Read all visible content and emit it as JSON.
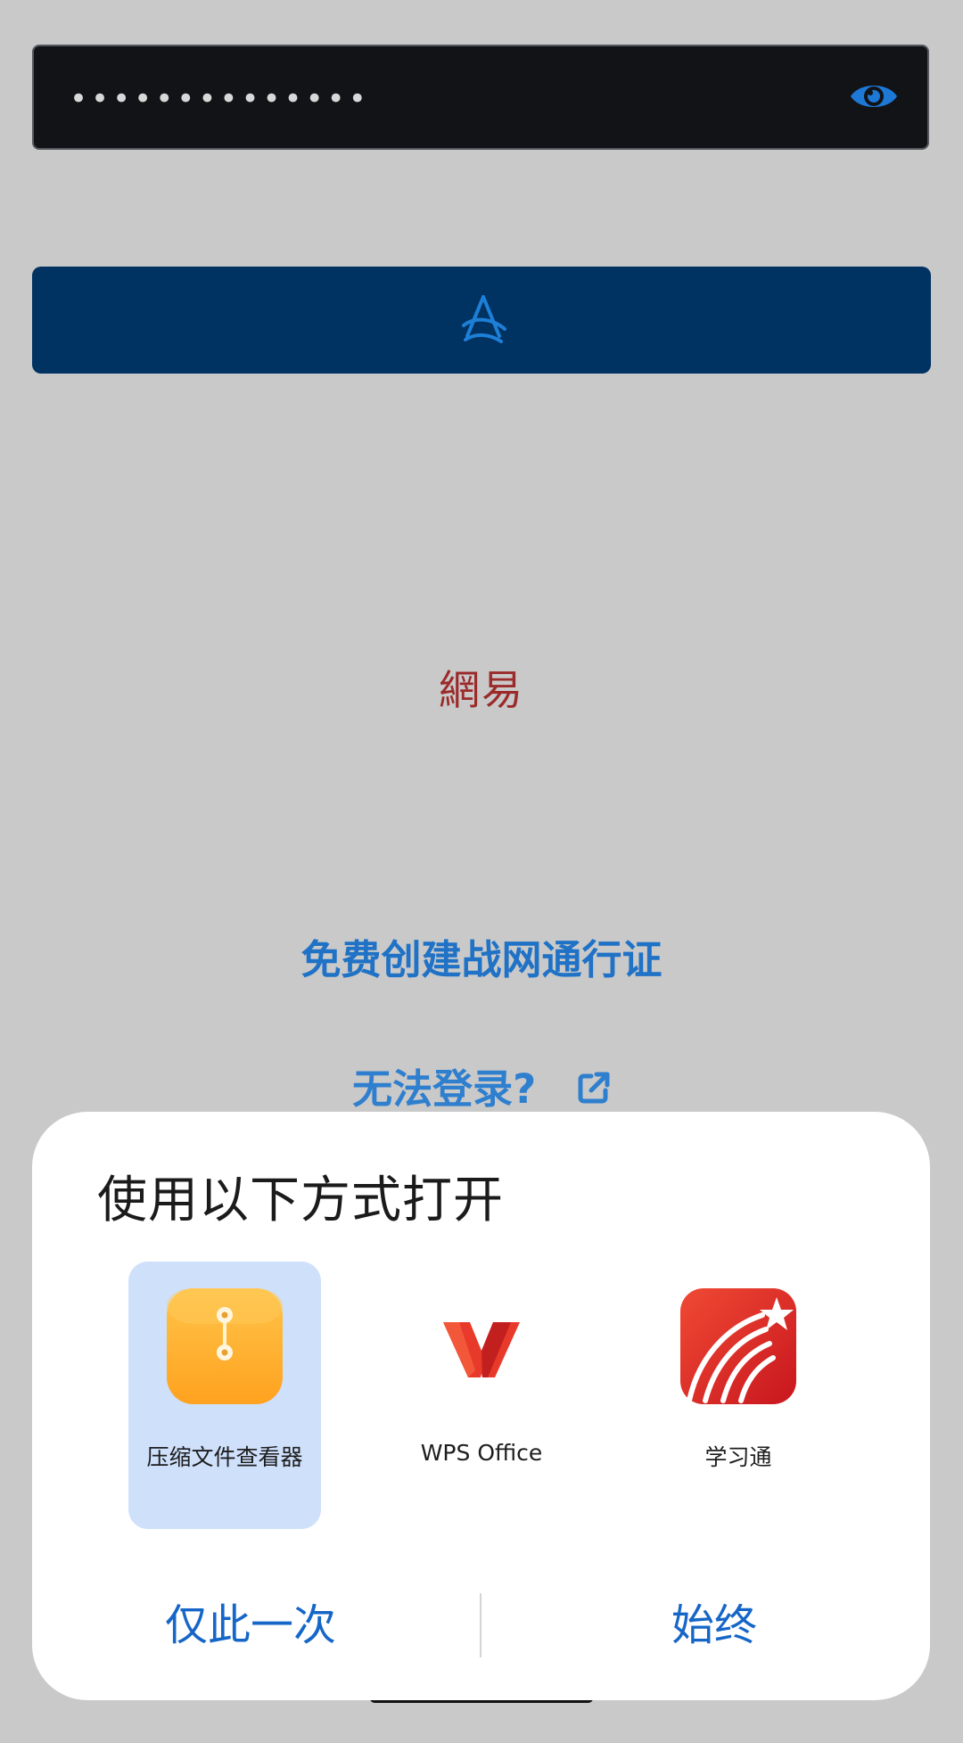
{
  "login": {
    "password_mask": "••••••••••••••",
    "show_password_icon": "eye-icon",
    "submit_icon": "loading-icon",
    "brand_logo": "網易",
    "create_account_link": "免费创建战网通行证",
    "cannot_login_link": "无法登录?",
    "cannot_login_icon": "external-link-icon"
  },
  "open_with_sheet": {
    "title": "使用以下方式打开",
    "apps": [
      {
        "label": "压缩文件查看器",
        "icon": "archive-viewer-icon",
        "selected": true
      },
      {
        "label": "WPS Office",
        "icon": "wps-office-icon",
        "selected": false
      },
      {
        "label": "学习通",
        "icon": "xuexitong-icon",
        "selected": false
      }
    ],
    "just_once_label": "仅此一次",
    "always_label": "始终"
  },
  "colors": {
    "background": "#c9c9c9",
    "login_button": "#003262",
    "link_blue": "#1f72c6",
    "action_blue": "#1666c8",
    "selected_app_bg": "#cfe0fb",
    "brand_red": "#9b2a2a"
  }
}
